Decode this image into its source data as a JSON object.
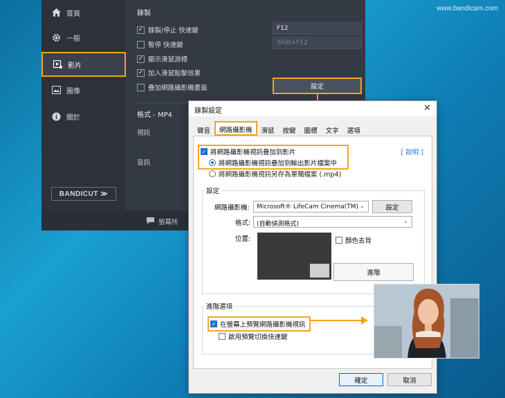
{
  "watermark": "www.bandicam.com",
  "app": {
    "sidebar": {
      "items": [
        {
          "label": "首頁",
          "icon": "home-icon"
        },
        {
          "label": "一般",
          "icon": "gear-icon"
        },
        {
          "label": "影片",
          "icon": "video-icon"
        },
        {
          "label": "圖像",
          "icon": "image-icon"
        },
        {
          "label": "關於",
          "icon": "info-icon"
        }
      ],
      "bandicut": "BANDICUT ≫"
    },
    "recording": {
      "title": "錄製",
      "options": [
        {
          "label": "錄製/停止 快速鍵",
          "checked": true,
          "hotkey": "F12"
        },
        {
          "label": "暫停 快速鍵",
          "checked": false,
          "hotkey": "Shift+F12"
        },
        {
          "label": "顯示滑鼠游標",
          "checked": true
        },
        {
          "label": "加入滑鼠點擊效果",
          "checked": true
        },
        {
          "label": "疊加網路攝影機畫面",
          "checked": false
        }
      ],
      "settings_button": "設定"
    },
    "format": {
      "title": "格式 - MP4",
      "video_label": "視訊",
      "audio_label": "音訊"
    },
    "footer_text": "螢幕所"
  },
  "dialog": {
    "title": "錄製設定",
    "tabs": [
      "聲音",
      "網路攝影機",
      "滑鼠",
      "按鍵",
      "圖標",
      "文字",
      "選項"
    ],
    "active_tab": "網路攝影機",
    "help_link": "[ 說明 ]",
    "add_webcam": "將網路攝影機視訊疊加到影片",
    "radio_overlay": "將網路攝影機視訊疊加到輸出影片檔案中",
    "radio_separate": "將網路攝影機視訊另存為單獨檔案 (.mp4)",
    "settings_group": {
      "title": "設定",
      "webcam_label": "網路攝影機:",
      "webcam_value": "Microsoft® LifeCam Cinema(TM)",
      "settings_button": "設定",
      "format_label": "格式:",
      "format_value": "(自動偵測格式)",
      "position_label": "位置:",
      "chroma_key": "顏色去背",
      "advanced_button": "進階"
    },
    "advanced_group": {
      "title": "進階選項",
      "preview_option": "在螢幕上預覽網路攝影機視訊",
      "hotkey_option": "啟用預覽切換快速鍵"
    },
    "ok_button": "確定",
    "cancel_button": "取消"
  },
  "colors": {
    "accent": "#f4a31f",
    "link": "#1f6fd1",
    "dark_bg": "#343a44"
  }
}
